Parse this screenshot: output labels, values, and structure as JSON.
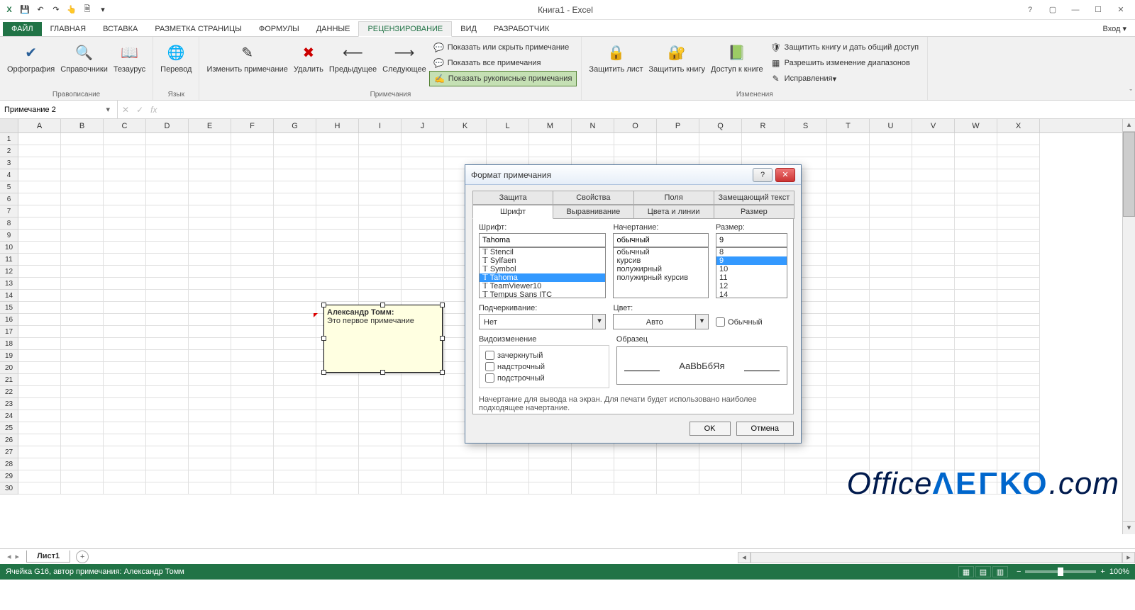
{
  "app": {
    "title": "Книга1 - Excel",
    "signin": "Вход"
  },
  "tabs": {
    "file": "ФАЙЛ",
    "home": "ГЛАВНАЯ",
    "insert": "ВСТАВКА",
    "layout": "РАЗМЕТКА СТРАНИЦЫ",
    "formulas": "ФОРМУЛЫ",
    "data": "ДАННЫЕ",
    "review": "РЕЦЕНЗИРОВАНИЕ",
    "view": "ВИД",
    "developer": "РАЗРАБОТЧИК"
  },
  "ribbon": {
    "proofing": {
      "label": "Правописание",
      "spelling": "Орфография",
      "research": "Справочники",
      "thesaurus": "Тезаурус"
    },
    "language": {
      "label": "Язык",
      "translate": "Перевод"
    },
    "comments": {
      "label": "Примечания",
      "edit": "Изменить примечание",
      "delete": "Удалить",
      "prev": "Предыдущее",
      "next": "Следующее",
      "showhide": "Показать или скрыть примечание",
      "showall": "Показать все примечания",
      "showink": "Показать рукописные примечания"
    },
    "protect": {
      "sheet": "Защитить лист",
      "book": "Защитить книгу",
      "share": "Доступ к книге"
    },
    "changes": {
      "label": "Изменения",
      "protectshare": "Защитить книгу и дать общий доступ",
      "allowranges": "Разрешить изменение диапазонов",
      "trackchanges": "Исправления"
    }
  },
  "namebox": "Примечание 2",
  "columns": [
    "A",
    "B",
    "C",
    "D",
    "E",
    "F",
    "G",
    "H",
    "I",
    "J",
    "K",
    "L",
    "M",
    "N",
    "O",
    "P",
    "Q",
    "R",
    "S",
    "T",
    "U",
    "V",
    "W",
    "X"
  ],
  "rows": 30,
  "comment": {
    "author": "Александр Томм:",
    "text": "Это первое примечание"
  },
  "dialog": {
    "title": "Формат примечания",
    "tabs_upper": {
      "protection": "Защита",
      "properties": "Свойства",
      "margins": "Поля",
      "alttext": "Замещающий текст"
    },
    "tabs_lower": {
      "font": "Шрифт",
      "align": "Выравнивание",
      "colors": "Цвета и линии",
      "size": "Размер"
    },
    "font_label": "Шрифт:",
    "font_value": "Tahoma",
    "font_list": [
      "Stencil",
      "Sylfaen",
      "Symbol",
      "Tahoma",
      "TeamViewer10",
      "Tempus Sans ITC"
    ],
    "font_selected": "Tahoma",
    "style_label": "Начертание:",
    "style_value": "обычный",
    "style_list": [
      "обычный",
      "курсив",
      "полужирный",
      "полужирный курсив"
    ],
    "size_label": "Размер:",
    "size_value": "9",
    "size_list": [
      "8",
      "9",
      "10",
      "11",
      "12",
      "14"
    ],
    "size_selected": "9",
    "underline_label": "Подчеркивание:",
    "underline_value": "Нет",
    "color_label": "Цвет:",
    "color_value": "Авто",
    "normal_font": "Обычный",
    "effects_label": "Видоизменение",
    "strike": "зачеркнутый",
    "superscript": "надстрочный",
    "subscript": "подстрочный",
    "preview_label": "Образец",
    "preview_text": "AaBbБбЯя",
    "hint": "Начертание для вывода на экран. Для печати будет использовано наиболее подходящее начертание.",
    "ok": "OK",
    "cancel": "Отмена"
  },
  "sheet": {
    "name": "Лист1"
  },
  "status": {
    "text": "Ячейка G16, автор примечания: Александр Томм",
    "zoom": "100%"
  },
  "watermark": {
    "office": "Office",
    "legko": "ΛΕΓΚΟ",
    "com": ".com"
  }
}
